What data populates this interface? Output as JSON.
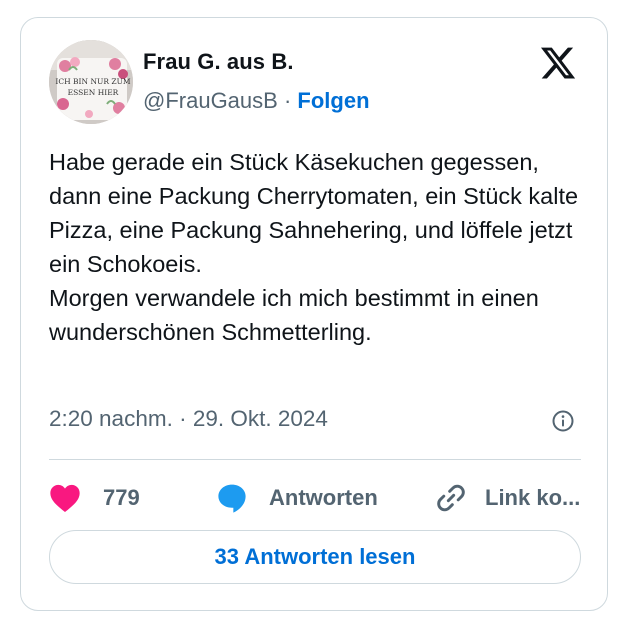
{
  "tweet": {
    "author": {
      "display_name": "Frau G. aus B.",
      "handle": "@FrauGausB",
      "separator": "·",
      "follow_label": "Folgen",
      "avatar_text": "ICH BIN NUR ZUM ESSEN HIER"
    },
    "logo_icon": "x-logo-icon",
    "text": "Habe gerade ein Stück Käsekuchen gegessen, dann eine Packung Cherrytomaten, ein Stück kalte Pizza, eine Packung Sahnehering, und löffele jetzt ein Schokoeis.\nMorgen verwandele ich mich bestimmt in einen wunderschönen Schmetterling.",
    "timestamp": "2:20 nachm. · 29. Okt. 2024",
    "info_icon": "info-icon",
    "actions": {
      "like_count": "779",
      "reply_label": "Antworten",
      "link_label": "Link ko..."
    },
    "read_replies_label": "33 Antworten lesen"
  },
  "colors": {
    "accent": "#006fd6",
    "like": "#f91880",
    "reply_bubble": "#1d9bf0",
    "muted_text": "#536471",
    "border": "#cfd9de"
  }
}
